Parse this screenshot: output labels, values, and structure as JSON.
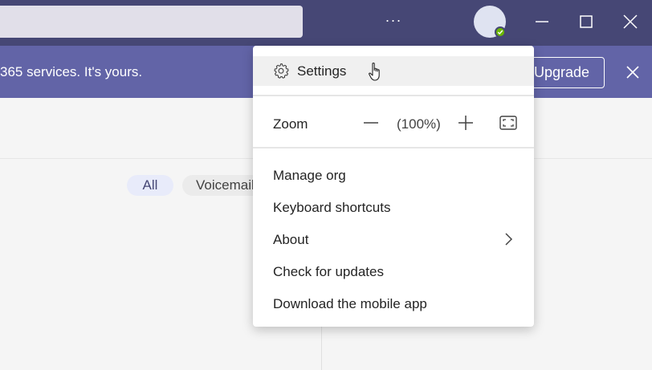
{
  "titlebar": {
    "more_label": "···",
    "icons": {
      "minimize": "minimize-icon",
      "maximize": "maximize-icon",
      "close": "close-icon"
    },
    "presence_status": "available",
    "presence_color": "#6bb700"
  },
  "banner": {
    "text": "365 services. It's yours.",
    "upgrade_label": "Upgrade"
  },
  "filters": {
    "all_label": "All",
    "voicemail_label": "Voicemail"
  },
  "menu": {
    "settings_label": "Settings",
    "zoom_label": "Zoom",
    "zoom_value": "(100%)",
    "items": [
      "Manage org",
      "Keyboard shortcuts",
      "About",
      "Check for updates",
      "Download the mobile app"
    ]
  },
  "colors": {
    "titlebar": "#464775",
    "banner": "#6264a7",
    "accent": "#6264a7"
  }
}
